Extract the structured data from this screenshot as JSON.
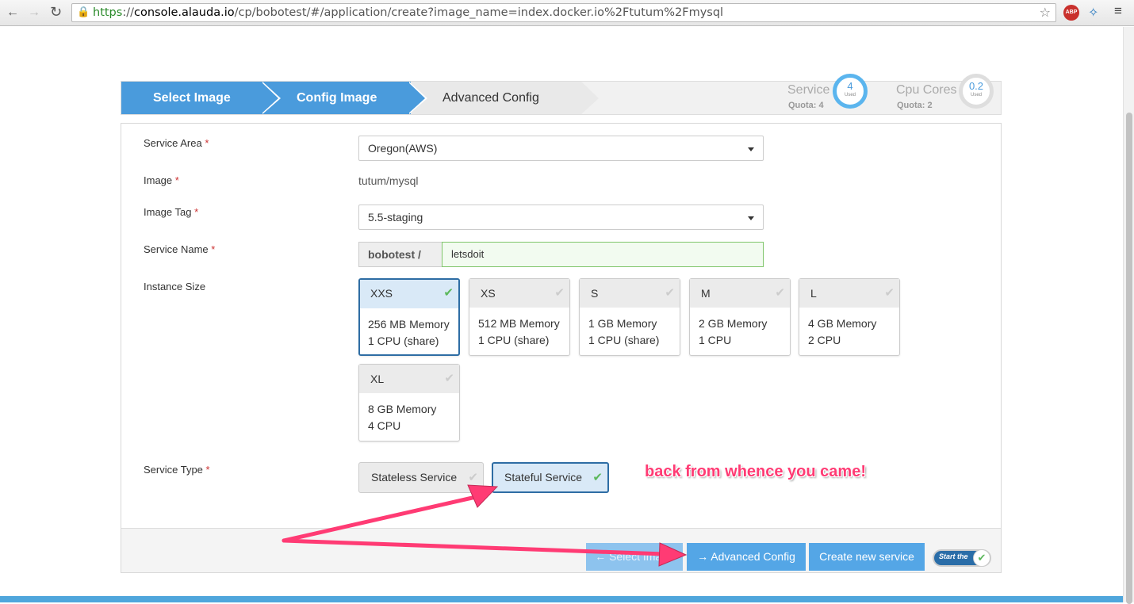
{
  "browser": {
    "url_https": "https",
    "url_sep": "://",
    "url_domain": "console.alauda.io",
    "url_path": "/cp/bobotest/#/application/create?image_name=index.docker.io%2Ftutum%2Fmysql",
    "abp_label": "ABP",
    "icons": [
      "back-arrow-icon",
      "forward-arrow-icon",
      "reload-icon",
      "lock-icon",
      "star-icon",
      "adblock-icon",
      "extension-icon",
      "menu-icon"
    ]
  },
  "steps": [
    {
      "label": "Select Image",
      "state": "done"
    },
    {
      "label": "Config Image",
      "state": "active"
    },
    {
      "label": "Advanced Config",
      "state": "pending"
    }
  ],
  "quota": {
    "service": {
      "label": "Service",
      "sub": "Quota: 4",
      "value": "4",
      "used": "Used"
    },
    "cpu": {
      "label": "Cpu Cores",
      "sub": "Quota: 2",
      "value": "0.2",
      "used": "Used"
    }
  },
  "form": {
    "service_area": {
      "label": "Service Area",
      "required": "*",
      "value": "Oregon(AWS)"
    },
    "image": {
      "label": "Image",
      "required": "*",
      "value": "tutum/mysql"
    },
    "image_tag": {
      "label": "Image Tag",
      "required": "*",
      "value": "5.5-staging"
    },
    "service_name": {
      "label": "Service Name",
      "required": "*",
      "namespace": "bobotest  /",
      "value": "letsdoit"
    },
    "instance_size": {
      "label": "Instance Size",
      "options": [
        {
          "name": "XXS",
          "memory": "256 MB Memory",
          "cpu": "1 CPU (share)",
          "selected": true
        },
        {
          "name": "XS",
          "memory": "512 MB Memory",
          "cpu": "1 CPU (share)",
          "selected": false
        },
        {
          "name": "S",
          "memory": "1 GB Memory",
          "cpu": "1 CPU (share)",
          "selected": false
        },
        {
          "name": "M",
          "memory": "2 GB Memory",
          "cpu": "1 CPU",
          "selected": false
        },
        {
          "name": "L",
          "memory": "4 GB Memory",
          "cpu": "2 CPU",
          "selected": false
        },
        {
          "name": "XL",
          "memory": "8 GB Memory",
          "cpu": "4 CPU",
          "selected": false
        }
      ]
    },
    "service_type": {
      "label": "Service Type",
      "required": "*",
      "options": [
        {
          "name": "Stateless Service",
          "selected": false
        },
        {
          "name": "Stateful Service",
          "selected": true
        }
      ]
    }
  },
  "annotation": "back from whence you came!",
  "footer": {
    "back_button": "← Select Image",
    "next_button": "→ Advanced Config",
    "create_button": "Create new service",
    "toggle_label": "Start the",
    "toggle_state": "on"
  },
  "colors": {
    "accent": "#4a9bdc",
    "annotation": "#ff3b74",
    "success": "#5cb85c"
  }
}
